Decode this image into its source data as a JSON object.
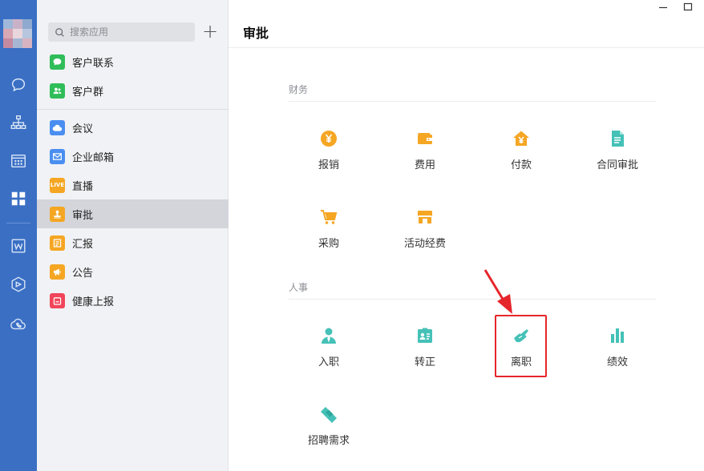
{
  "colors": {
    "rail_bg": "#3a6fc4",
    "sidebar_bg": "#f1f2f5",
    "sidebar_active": "#d3d5db",
    "finance_icon": "#f5a623",
    "hr_icon": "#45c1b7",
    "highlight": "#e5262b"
  },
  "rail": {
    "icons": [
      "chat-icon",
      "org-chart-icon",
      "calendar-icon",
      "apps-grid-icon",
      "doc-w-icon",
      "cube-icon",
      "cloud-phone-icon"
    ]
  },
  "sidebar": {
    "search": {
      "placeholder": "搜索应用"
    },
    "add_button": "+",
    "items": [
      {
        "label": "客户联系",
        "icon": "chat-bubble-icon",
        "color": "#2fbd5a"
      },
      {
        "label": "客户群",
        "icon": "group-icon",
        "color": "#2fbd5a"
      },
      {
        "label": "会议",
        "icon": "cloud-meeting-icon",
        "color": "#4a8ef0"
      },
      {
        "label": "企业邮箱",
        "icon": "mail-icon",
        "color": "#4a8ef0"
      },
      {
        "label": "直播",
        "icon": "live-icon",
        "icon_text": "LIVE",
        "color": "#f5a623"
      },
      {
        "label": "审批",
        "icon": "stamp-icon",
        "color": "#f5a623"
      },
      {
        "label": "汇报",
        "icon": "report-icon",
        "color": "#f5a623"
      },
      {
        "label": "公告",
        "icon": "megaphone-icon",
        "color": "#f5a623"
      },
      {
        "label": "健康上报",
        "icon": "health-report-icon",
        "color": "#f0455a"
      }
    ]
  },
  "main": {
    "title": "审批",
    "sections": [
      {
        "label": "财务",
        "apps": [
          {
            "label": "报销",
            "icon": "yuan-coin-icon"
          },
          {
            "label": "费用",
            "icon": "wallet-icon"
          },
          {
            "label": "付款",
            "icon": "house-yuan-icon"
          },
          {
            "label": "合同审批",
            "icon": "contract-doc-icon"
          },
          {
            "label": "采购",
            "icon": "shopping-cart-icon"
          },
          {
            "label": "活动经费",
            "icon": "store-icon"
          }
        ]
      },
      {
        "label": "人事",
        "apps": [
          {
            "label": "入职",
            "icon": "person-tie-icon"
          },
          {
            "label": "转正",
            "icon": "badge-clipboard-icon"
          },
          {
            "label": "离职",
            "icon": "hand-wave-icon"
          },
          {
            "label": "绩效",
            "icon": "bar-chart-icon"
          },
          {
            "label": "招聘需求",
            "icon": "handshake-icon"
          }
        ]
      }
    ]
  }
}
